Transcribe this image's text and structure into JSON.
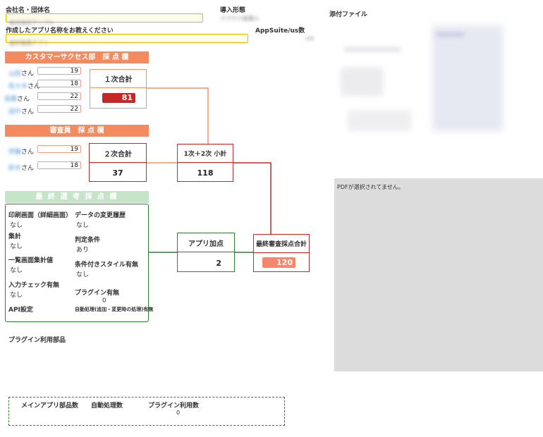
{
  "company": {
    "label": "会社名・団体名",
    "value": "株式会社サンプル"
  },
  "deploy": {
    "label": "導入形態",
    "value": "クラウド版導入"
  },
  "app_name": {
    "label": "作成したアプリ名称をお教えください",
    "value": "案件管理アプリ"
  },
  "appsuite": {
    "label": "AppSuite/us数",
    "value": "100"
  },
  "attachment": {
    "label": "添付ファイル"
  },
  "cs_section": {
    "title": "カスタマーサクセス部　採 点 欄",
    "people": [
      {
        "name": "山田",
        "suffix": "さん",
        "score": "19"
      },
      {
        "name": "佐々木",
        "suffix": "さん",
        "score": "18"
      },
      {
        "name": "高橋",
        "suffix": "さん",
        "score": "22"
      },
      {
        "name": "田中",
        "suffix": "さん",
        "score": "22"
      }
    ],
    "total_label": "１次合計",
    "total_value": "81"
  },
  "judge_section": {
    "title": "審査員　採 点 欄",
    "people": [
      {
        "name": "伊藤",
        "suffix": "さん",
        "score": "19"
      },
      {
        "name": "鈴木",
        "suffix": "さん",
        "score": "18"
      }
    ],
    "total_label": "２次合計",
    "total_value": "37"
  },
  "subtotal": {
    "label": "1次＋2次 小計",
    "value": "118"
  },
  "bonus": {
    "label": "アプリ加点",
    "value": "2"
  },
  "final": {
    "label": "最終審査採点合計",
    "value": "120"
  },
  "final_section": {
    "title": "最 終 選 考 採 点 欄",
    "items": [
      {
        "label": "印刷画面（詳細画面）",
        "value": "なし"
      },
      {
        "label": "データの変更履歴",
        "value": "なし"
      },
      {
        "label": "集計",
        "value": "なし"
      },
      {
        "label": "判定条件",
        "value": "あり"
      },
      {
        "label": "一覧画面集計値",
        "value": "なし"
      },
      {
        "label": "条件付きスタイル有無",
        "value": "なし"
      },
      {
        "label": "入力チェック有無",
        "value": "なし"
      },
      {
        "label": "プラグイン有無",
        "value": "0"
      },
      {
        "label": "API設定",
        "value": ""
      },
      {
        "label": "自動処理(追加・変更時の処理)有無",
        "value": ""
      }
    ]
  },
  "plugin_parts": {
    "label": "プラグイン利用部品"
  },
  "bottom_stats": {
    "main_parts_label": "メインアプリ部品数",
    "auto_label": "自動処理数",
    "plugin_label": "プラグイン利用数",
    "plugin_value": "0"
  },
  "pdf": {
    "message": "PDFが選択されてません。"
  },
  "colors": {
    "orange_header": "#f58a5e",
    "green_header": "#c6e4c8",
    "red": "#c62828",
    "light_red": "#f8866a",
    "green": "#2e7d32",
    "gold": "#e6b800"
  }
}
